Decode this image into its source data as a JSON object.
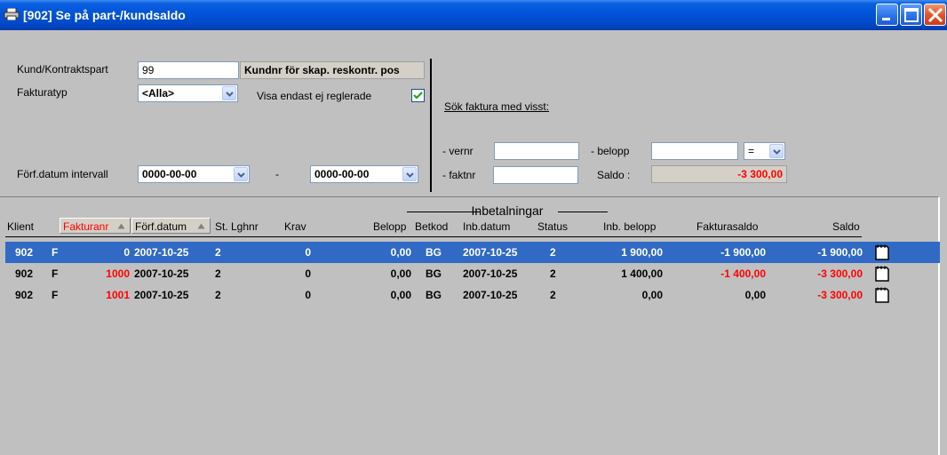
{
  "window": {
    "title": "[902]  Se på part-/kundsaldo"
  },
  "form": {
    "kund_label": "Kund/Kontraktspart",
    "kund_value": "99",
    "kund_desc": "Kundnr för skap. reskontr. pos",
    "fakturatyp_label": "Fakturatyp",
    "fakturatyp_value": "<Alla>",
    "visa_label": "Visa endast ej reglerade",
    "visa_checked": true,
    "forf_label": "Förf.datum intervall",
    "forf_from": "0000-00-00",
    "forf_dash": "-",
    "forf_to": "0000-00-00"
  },
  "search": {
    "heading": "Sök faktura med visst:",
    "vernr_label": "- vernr",
    "vernr_value": "",
    "belopp_label": "- belopp",
    "belopp_value": "",
    "operator": "=",
    "faktnr_label": "- faktnr",
    "faktnr_value": "",
    "saldo_label": "Saldo :",
    "saldo_value": "-3 300,00"
  },
  "table": {
    "group_header": "Inbetalningar",
    "columns": {
      "klient": "Klient",
      "fakturanr": "Fakturanr",
      "forfdatum": "Förf.datum",
      "st_lghnr": "St. Lghnr",
      "krav": "Krav",
      "belopp": "Belopp",
      "betkod": "Betkod",
      "inbdatum": "Inb.datum",
      "status": "Status",
      "inb_belopp": "Inb. belopp",
      "fakturasaldo": "Fakturasaldo",
      "saldo": "Saldo"
    },
    "rows": [
      {
        "klient": "902",
        "typ": "F",
        "fakturanr": "0",
        "forfdatum": "2007-10-25",
        "st": "2",
        "krav": "0",
        "belopp": "0,00",
        "betkod": "BG",
        "inbdatum": "2007-10-25",
        "status": "2",
        "inb_belopp": "1 900,00",
        "fakturasaldo": "-1 900,00",
        "saldo": "-1 900,00"
      },
      {
        "klient": "902",
        "typ": "F",
        "fakturanr": "1000",
        "forfdatum": "2007-10-25",
        "st": "2",
        "krav": "0",
        "belopp": "0,00",
        "betkod": "BG",
        "inbdatum": "2007-10-25",
        "status": "2",
        "inb_belopp": "1 400,00",
        "fakturasaldo": "-1 400,00",
        "saldo": "-3 300,00"
      },
      {
        "klient": "902",
        "typ": "F",
        "fakturanr": "1001",
        "forfdatum": "2007-10-25",
        "st": "2",
        "krav": "0",
        "belopp": "0,00",
        "betkod": "BG",
        "inbdatum": "2007-10-25",
        "status": "2",
        "inb_belopp": "0,00",
        "fakturasaldo": "0,00",
        "saldo": "-3 300,00"
      }
    ]
  },
  "icons": {
    "app": "printer-icon",
    "minimize": "minimize-icon",
    "maximize": "maximize-icon",
    "close": "close-icon",
    "row_note": "note-icon"
  },
  "colors": {
    "titlebar": "#0052d6",
    "selection": "#316ac5",
    "negative": "#ff0000",
    "window_bg": "#c0c0c0"
  }
}
